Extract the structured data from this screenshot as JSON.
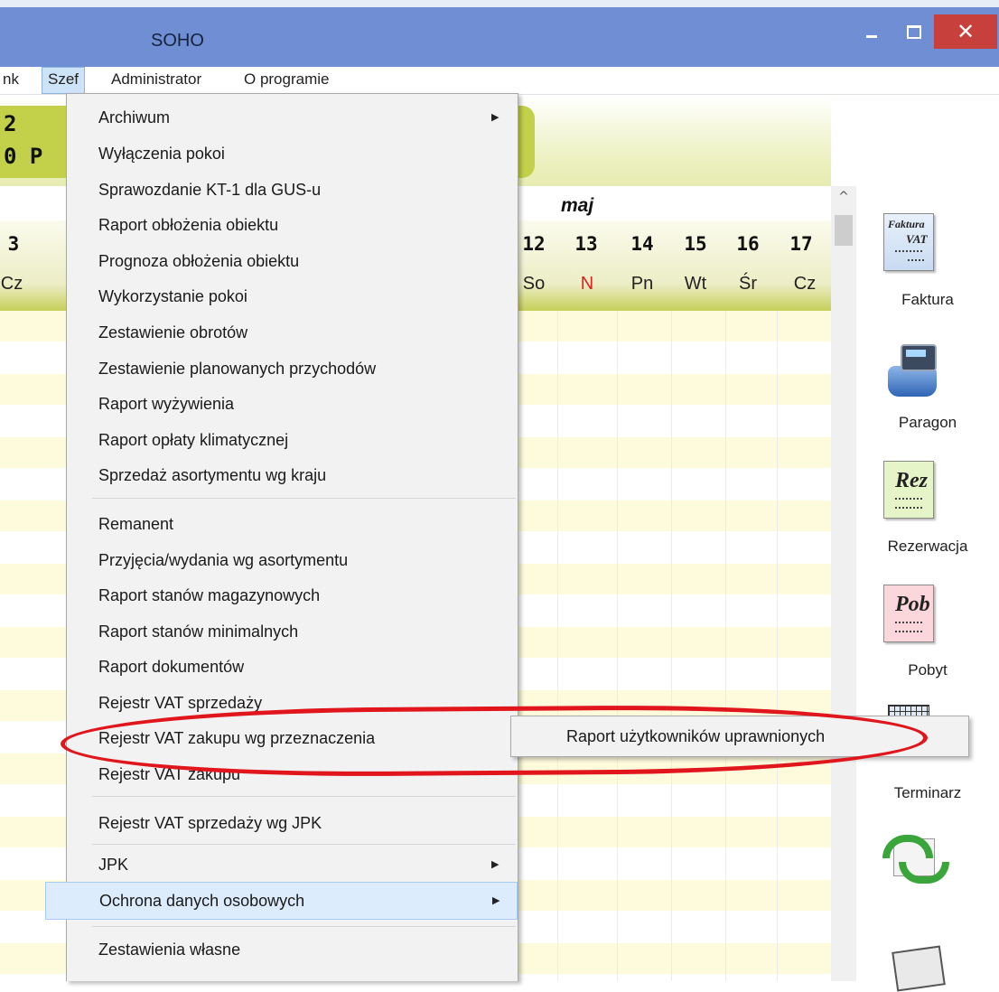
{
  "window": {
    "title": "SOHO",
    "minimize_icon": "minimize-icon",
    "maximize_icon": "maximize-icon",
    "close_icon": "close-icon",
    "close_glyph": "✕"
  },
  "menubar": {
    "items": [
      {
        "label": "nk"
      },
      {
        "label": "Szef"
      },
      {
        "label": "Administrator"
      },
      {
        "label": "O programie"
      }
    ]
  },
  "banner": {
    "line1": "2",
    "line2": "0 P"
  },
  "calendar": {
    "month": "maj",
    "days": [
      {
        "num": "3",
        "dow": "Cz",
        "red": false
      },
      {
        "num": "12",
        "dow": "So",
        "red": false
      },
      {
        "num": "13",
        "dow": "N",
        "red": true
      },
      {
        "num": "14",
        "dow": "Pn",
        "red": false
      },
      {
        "num": "15",
        "dow": "Wt",
        "red": false
      },
      {
        "num": "16",
        "dow": "Śr",
        "red": false
      },
      {
        "num": "17",
        "dow": "Cz",
        "red": false
      }
    ]
  },
  "toolbar": {
    "items": [
      {
        "label": "Faktura",
        "icon": "invoice-icon",
        "doc_text": "Faktura",
        "doc_sub": "VAT"
      },
      {
        "label": "Paragon",
        "icon": "cash-register-icon"
      },
      {
        "label": "Rezerwacja",
        "icon": "reservation-icon",
        "doc_text": "Rez"
      },
      {
        "label": "Pobyt",
        "icon": "stay-icon",
        "doc_text": "Pob"
      },
      {
        "label": "Terminarz",
        "icon": "calendar-grid-icon"
      },
      {
        "label": "",
        "icon": "sync-mail-icon"
      }
    ]
  },
  "dropdown": {
    "items": [
      {
        "label": "Archiwum",
        "submenu": true
      },
      {
        "label": "Wyłączenia pokoi"
      },
      {
        "label": "Sprawozdanie KT-1 dla GUS-u"
      },
      {
        "label": "Raport obłożenia obiektu"
      },
      {
        "label": "Prognoza obłożenia obiektu"
      },
      {
        "label": "Wykorzystanie pokoi"
      },
      {
        "label": "Zestawienie obrotów"
      },
      {
        "label": "Zestawienie planowanych przychodów"
      },
      {
        "label": "Raport wyżywienia"
      },
      {
        "label": "Raport opłaty klimatycznej"
      },
      {
        "label": "Sprzedaż asortymentu wg kraju"
      },
      {
        "label": "Remanent"
      },
      {
        "label": "Przyjęcia/wydania wg asortymentu"
      },
      {
        "label": "Raport stanów magazynowych"
      },
      {
        "label": "Raport stanów minimalnych"
      },
      {
        "label": "Raport dokumentów"
      },
      {
        "label": "Rejestr VAT sprzedaży"
      },
      {
        "label": "Rejestr VAT zakupu wg przeznaczenia"
      },
      {
        "label": "Rejestr VAT zakupu"
      },
      {
        "label": "Rejestr VAT sprzedaży wg JPK"
      },
      {
        "label": "JPK",
        "submenu": true
      },
      {
        "label": "Ochrona danych osobowych",
        "submenu": true,
        "highlighted": true
      },
      {
        "label": "Zestawienia własne"
      }
    ]
  },
  "submenu": {
    "items": [
      {
        "label": "Raport użytkowników uprawnionych"
      }
    ]
  },
  "colors": {
    "titlebar": "#6f8ed3",
    "close": "#c8403c",
    "banner": "#c3d04a",
    "annotation": "#e0161c",
    "sunday": "#e02020"
  }
}
